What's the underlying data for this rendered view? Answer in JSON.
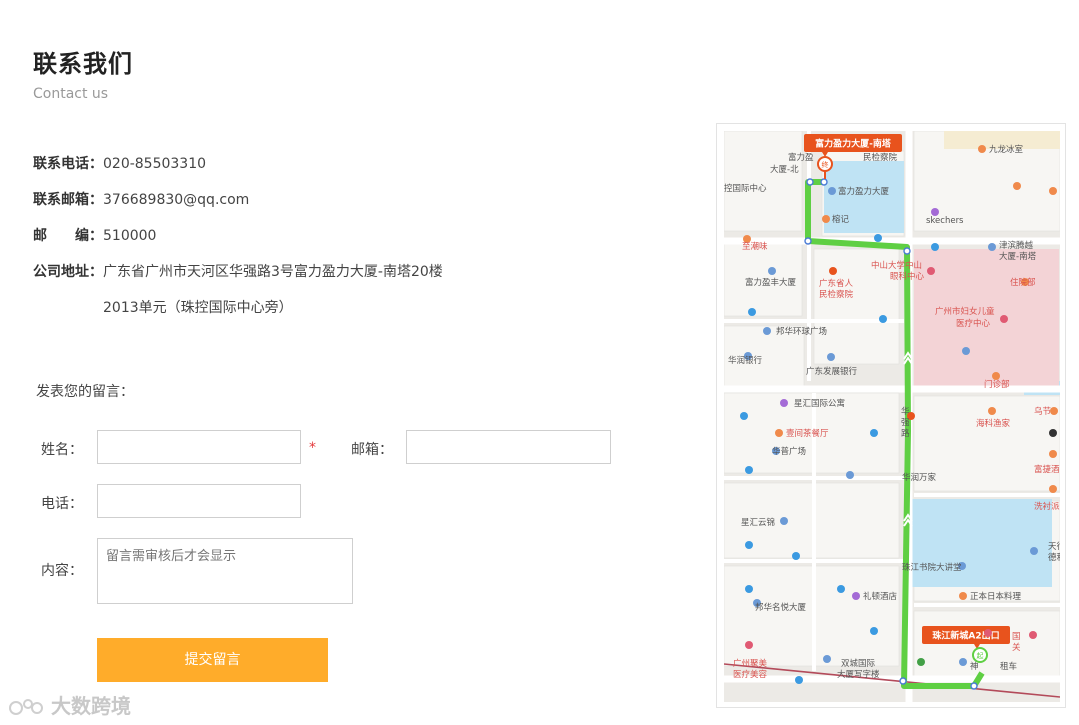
{
  "header": {
    "title": "联系我们",
    "subtitle": "Contact us"
  },
  "contact": {
    "phone_label": "联系电话：",
    "phone": "020-85503310",
    "email_label": "联系邮箱：",
    "email": "376689830@qq.com",
    "zip_label": "邮　　编：",
    "zip": "510000",
    "address_label": "公司地址：",
    "address_line1": "广东省广州市天河区华强路3号富力盈力大厦-南塔20楼",
    "address_line2": "2013单元（珠控国际中心旁）"
  },
  "form": {
    "heading": "发表您的留言：",
    "name_label": "姓名：",
    "required_mark": "*",
    "email_label": "邮箱：",
    "phone_label": "电话：",
    "content_label": "内容：",
    "content_placeholder": "留言需审核后才会显示",
    "submit_label": "提交留言"
  },
  "map": {
    "dest_label": "富力盈力大厦-南塔",
    "origin_label": "珠江新城A2出口",
    "end_marker": "终",
    "start_marker": "起",
    "places": [
      "富力盈",
      "大厦-北",
      "民检察院",
      "九龙冰室",
      "控国际中心",
      "富力盈力大厦",
      "榕记",
      "skechers",
      "至潮味",
      "中山大学中山",
      "眼科中心",
      "津滨腾越",
      "大厦-南塔",
      "住院部",
      "富力盈丰大厦",
      "广东省人",
      "民检察院",
      "广州市妇女儿童",
      "医疗中心",
      "邦华环球广场",
      "华润银行",
      "广东发展银行",
      "门诊部",
      "星汇国际公寓",
      "乌节",
      "海科渔家",
      "壹间茶餐厅",
      "华",
      "强",
      "路",
      "富捷酒",
      "华普广场",
      "华润万家",
      "洗衬派",
      "星汇云锦",
      "天行",
      "德利",
      "珠江书院大讲堂",
      "礼顿酒店",
      "正本日本料理",
      "邦华名悦大厦",
      "国",
      "关",
      "广州聚美",
      "医疗美容",
      "双城国际",
      "大厦写字楼",
      "神",
      "租车"
    ],
    "colors": {
      "route": "#5fcf43",
      "callout": "#e8531d",
      "water": "#bfe3f4",
      "hospital": "#f3d3d6"
    }
  },
  "watermark": {
    "text": "大数跨境"
  }
}
